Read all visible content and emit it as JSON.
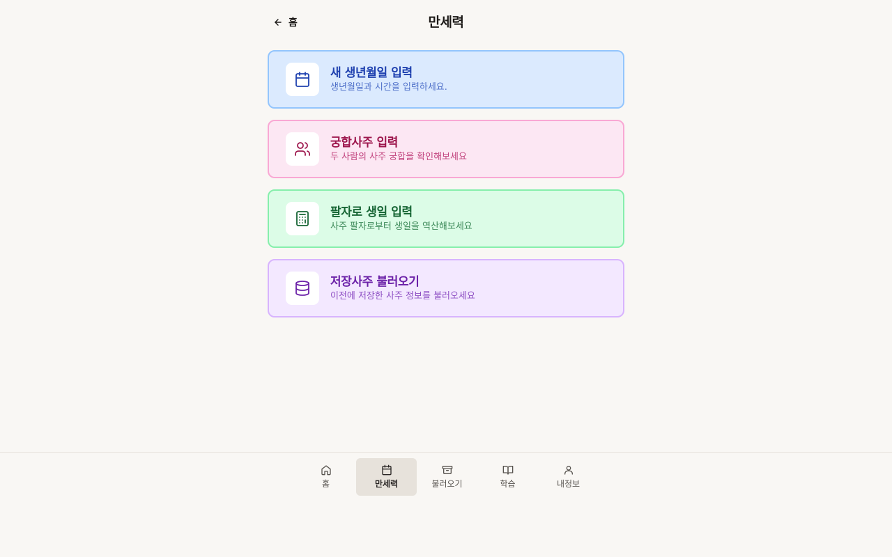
{
  "header": {
    "back_label": "홈",
    "title": "만세력"
  },
  "cards": [
    {
      "title": "새 생년월일 입력",
      "subtitle": "생년월일과 시간을 입력하세요.",
      "icon": "calendar-icon",
      "color": "#dbeafe"
    },
    {
      "title": "궁합사주 입력",
      "subtitle": "두 사람의 사주 궁합을 확인해보세요",
      "icon": "users-icon",
      "color": "#fce7f3"
    },
    {
      "title": "팔자로 생일 입력",
      "subtitle": "사주 팔자로부터 생일을 역산해보세요",
      "icon": "calculator-icon",
      "color": "#dcfce7"
    },
    {
      "title": "저장사주 불러오기",
      "subtitle": "이전에 저장한 사주 정보를 불러오세요",
      "icon": "database-icon",
      "color": "#f3e8ff"
    }
  ],
  "bottom_nav": {
    "active": "만세력",
    "items": [
      {
        "label": "홈",
        "icon": "home-icon"
      },
      {
        "label": "만세력",
        "icon": "calendar-icon"
      },
      {
        "label": "불러오기",
        "icon": "archive-icon"
      },
      {
        "label": "학습",
        "icon": "book-open-icon"
      },
      {
        "label": "내정보",
        "icon": "user-icon"
      }
    ]
  }
}
